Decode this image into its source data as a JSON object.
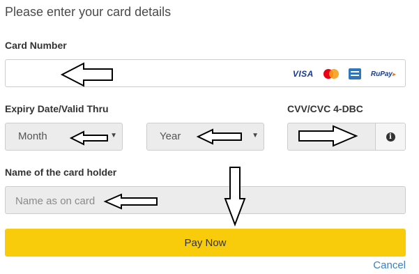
{
  "form": {
    "title": "Please enter your card details"
  },
  "card_number": {
    "label": "Card Number",
    "value": "",
    "logos": {
      "visa": "VISA",
      "rupay": "RuPay"
    }
  },
  "expiry": {
    "label": "Expiry Date/Valid Thru",
    "month_selected": "Month",
    "year_selected": "Year"
  },
  "cvv": {
    "label": "CVV/CVC 4-DBC",
    "value": "",
    "info_icon": "i"
  },
  "card_holder": {
    "label": "Name of the card holder",
    "placeholder": "Name as on card"
  },
  "actions": {
    "pay_label": "Pay Now",
    "cancel_label": "Cancel"
  },
  "colors": {
    "pay_button": "#f9cc0b",
    "cancel_link": "#3a7fc1",
    "field_disabled_bg": "#ececec"
  },
  "icons": {
    "caret": "chevron-down-icon",
    "info": "info-icon",
    "annotation": "arrow-icon"
  }
}
